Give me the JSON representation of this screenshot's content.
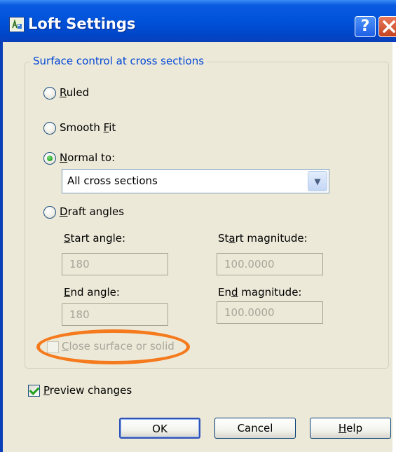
{
  "window": {
    "title": "Loft Settings",
    "help_label": "?"
  },
  "group": {
    "legend": "Surface control at cross sections"
  },
  "options": {
    "ruled": {
      "first": "R",
      "rest": "uled",
      "checked": false
    },
    "smooth_fit": {
      "before": "Smooth ",
      "key": "F",
      "after": "it",
      "checked": false
    },
    "normal_to": {
      "first": "N",
      "rest": "ormal to:",
      "checked": true,
      "selected": "All cross sections"
    },
    "draft_angles": {
      "first": "D",
      "rest": "raft angles",
      "checked": false
    }
  },
  "draft": {
    "start_angle": {
      "key": "S",
      "rest": "tart angle:",
      "value": "180"
    },
    "start_magnitude": {
      "before": "St",
      "key": "a",
      "after": "rt magnitude:",
      "value": "100.0000"
    },
    "end_angle": {
      "key": "E",
      "rest": "nd angle:",
      "value": "180"
    },
    "end_magnitude": {
      "before": "En",
      "key": "d",
      "after": " magnitude:",
      "value": "100.0000"
    }
  },
  "close_surface": {
    "key": "C",
    "rest": "lose surface or solid",
    "checked": false,
    "enabled": false
  },
  "preview": {
    "key": "P",
    "rest": "review changes",
    "checked": true
  },
  "buttons": {
    "ok": "OK",
    "cancel": "Cancel",
    "help_key": "H",
    "help_rest": "elp"
  },
  "colors": {
    "titlebar": "#0052d9",
    "dialog_bg": "#ece9d8",
    "legend": "#0046d5",
    "highlight_ring": "#f47a1d"
  }
}
